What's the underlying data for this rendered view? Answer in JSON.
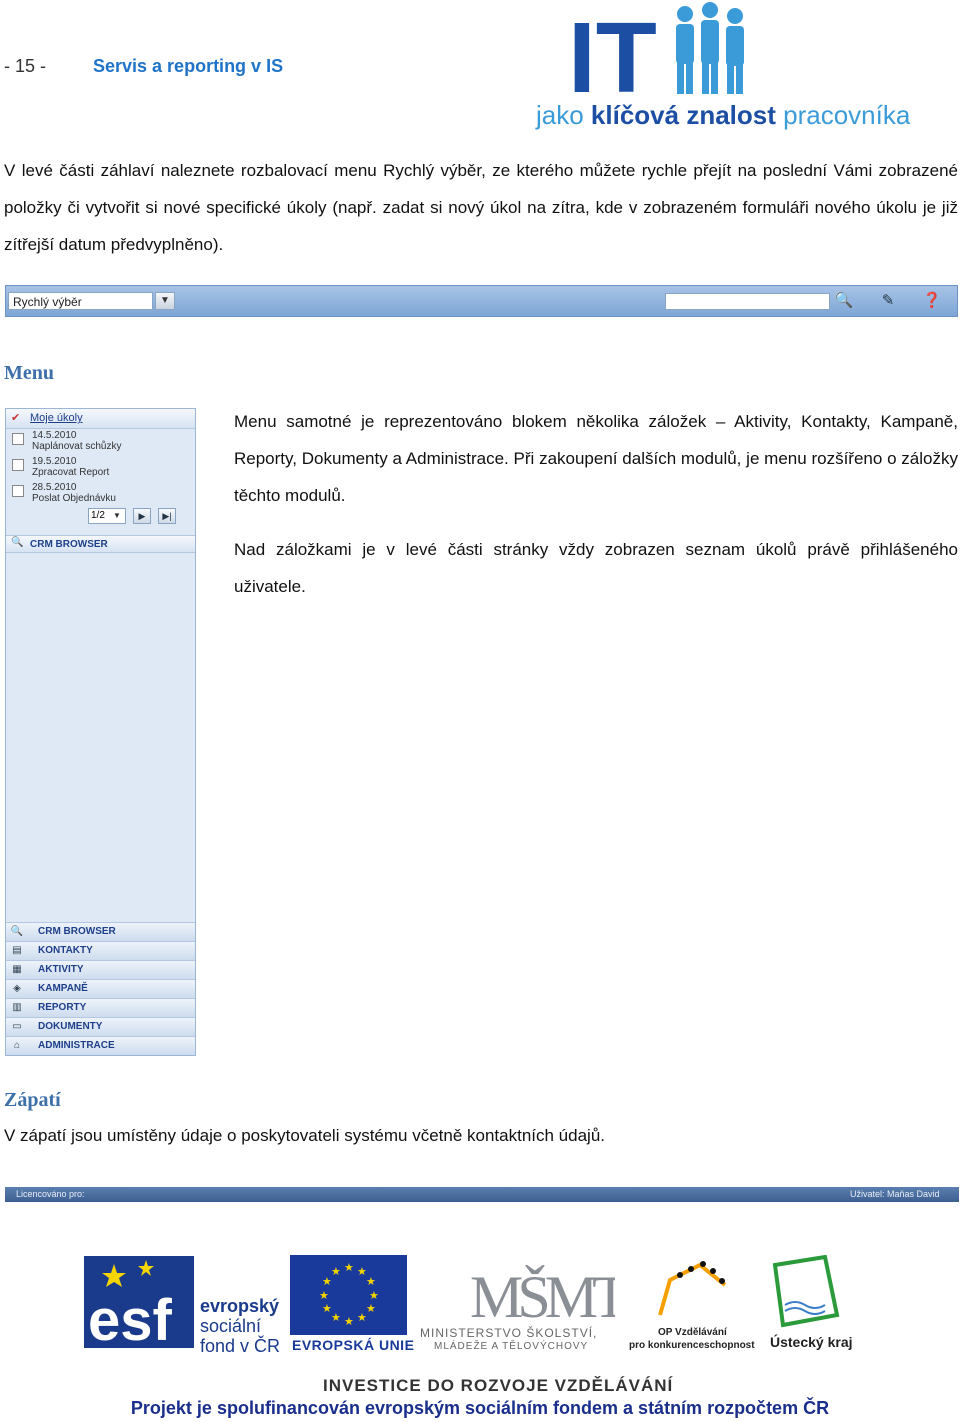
{
  "header": {
    "page_number": "- 15 -",
    "section_title": "Servis a reporting v IS",
    "logo": {
      "big": "IT",
      "line_plain": "jako ",
      "line_bold": "klíčová znalost",
      "line_tail": " pracovníka"
    }
  },
  "intro_paragraph": "V levé části záhlaví naleznete rozbalovací menu Rychlý výběr, ze kterého můžete rychle přejít na poslední Vámi zobrazené položky či vytvořit si nové specifické úkoly (např. zadat si nový úkol na zítra, kde v zobrazeném formuláři nového úkolu je již zítřejší datum předvyplněno).",
  "quickbar": {
    "select_value": "Rychlý výběr",
    "icons": [
      "search-icon",
      "edit-icon",
      "help-icon"
    ]
  },
  "menu_section": {
    "heading": "Menu",
    "paragraph1": "Menu samotné je reprezentováno blokem několika záložek – Aktivity, Kontakty, Kampaně, Reporty, Dokumenty a Administrace. Při zakoupení dalších modulů, je menu rozšířeno o záložky těchto modulů.",
    "paragraph2": "Nad záložkami je v levé části stránky vždy zobrazen seznam úkolů právě přihlášeného uživatele."
  },
  "sidebar": {
    "tasks_title": "Moje úkoly",
    "tasks": [
      {
        "date": "14.5.2010",
        "name": "Naplánovat schůzky"
      },
      {
        "date": "19.5.2010",
        "name": "Zpracovat Report"
      },
      {
        "date": "28.5.2010",
        "name": "Poslat Objednávku"
      }
    ],
    "pager": "1/2",
    "crm_browser_top": "CRM BROWSER",
    "nav_items": [
      {
        "label": "CRM BROWSER",
        "icon": "search-icon"
      },
      {
        "label": "KONTAKTY",
        "icon": "contacts-icon"
      },
      {
        "label": "AKTIVITY",
        "icon": "activities-icon"
      },
      {
        "label": "KAMPANĚ",
        "icon": "campaigns-icon"
      },
      {
        "label": "REPORTY",
        "icon": "reports-icon"
      },
      {
        "label": "DOKUMENTY",
        "icon": "documents-icon"
      },
      {
        "label": "ADMINISTRACE",
        "icon": "admin-icon"
      }
    ]
  },
  "footer_section": {
    "heading": "Zápatí",
    "paragraph": "V zápatí jsou umístěny údaje o poskytovateli systému včetně kontaktních údajů.",
    "bar_left": "Licencováno pro:",
    "bar_right": "Uživatel: Maňas David"
  },
  "logos": {
    "esf_line1": "evropský",
    "esf_line2": "sociální",
    "esf_line3": "fond v ČR",
    "eu": "EVROPSKÁ UNIE",
    "msmt_line1": "MINISTERSTVO ŠKOLSTVÍ,",
    "msmt_line2": "MLÁDEŽE A TĚLOVÝCHOVY",
    "op_line1": "OP Vzdělávání",
    "op_line2": "pro konkurenceschopnost",
    "ustecky": "Ústecký kraj",
    "invest": "INVESTICE DO ROZVOJE VZDĚLÁVÁNÍ",
    "project": "Projekt je spolufinancován evropským sociálním fondem a státním rozpočtem ČR"
  }
}
